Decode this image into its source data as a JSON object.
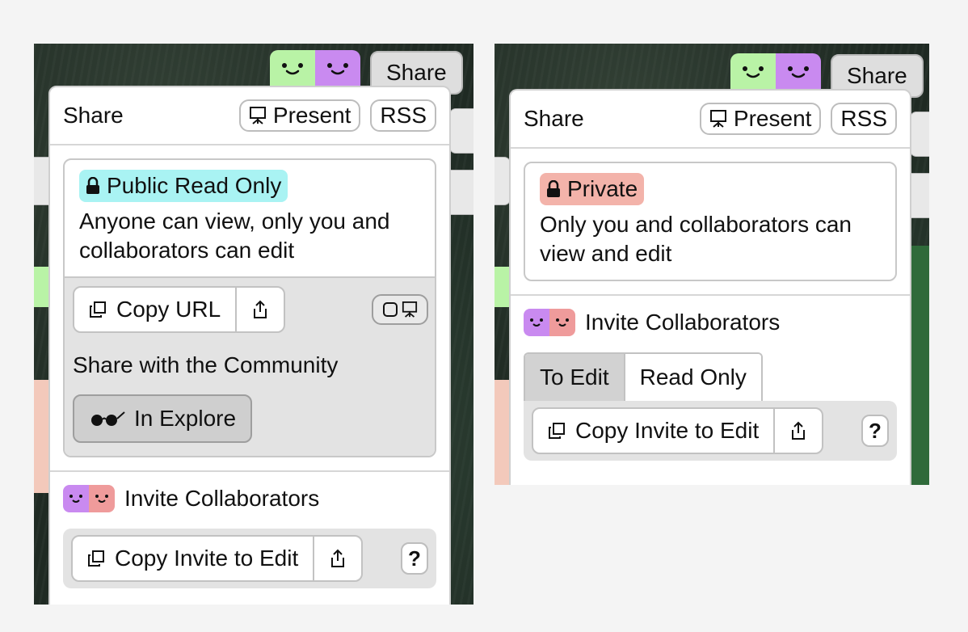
{
  "colors": {
    "green_face": "#b9f3a6",
    "purple_face": "#c98af0",
    "pink_face": "#ef9b9b",
    "public_badge": "#a9f3f3",
    "private_badge": "#f3b3aa"
  },
  "left_panel": {
    "share_button": "Share",
    "popover": {
      "title": "Share",
      "present_label": "Present",
      "rss_label": "RSS",
      "access": {
        "badge": "Public Read Only",
        "description": "Anyone can view, only you and collaborators can edit"
      },
      "copy_url_label": "Copy URL",
      "community_heading": "Share with the Community",
      "explore_label": "In Explore",
      "invite_heading": "Invite Collaborators",
      "copy_invite_label": "Copy Invite to Edit",
      "help_label": "?"
    }
  },
  "right_panel": {
    "share_button": "Share",
    "popover": {
      "title": "Share",
      "present_label": "Present",
      "rss_label": "RSS",
      "access": {
        "badge": "Private",
        "description": "Only you and collaborators can view and edit"
      },
      "invite_heading": "Invite Collaborators",
      "tabs": [
        "To Edit",
        "Read Only"
      ],
      "copy_invite_label": "Copy Invite to Edit",
      "help_label": "?"
    }
  },
  "icons": [
    "lock-icon",
    "present-icon",
    "copy-icon",
    "share-out-icon",
    "glasses-icon",
    "frame-icon",
    "face-icon"
  ]
}
